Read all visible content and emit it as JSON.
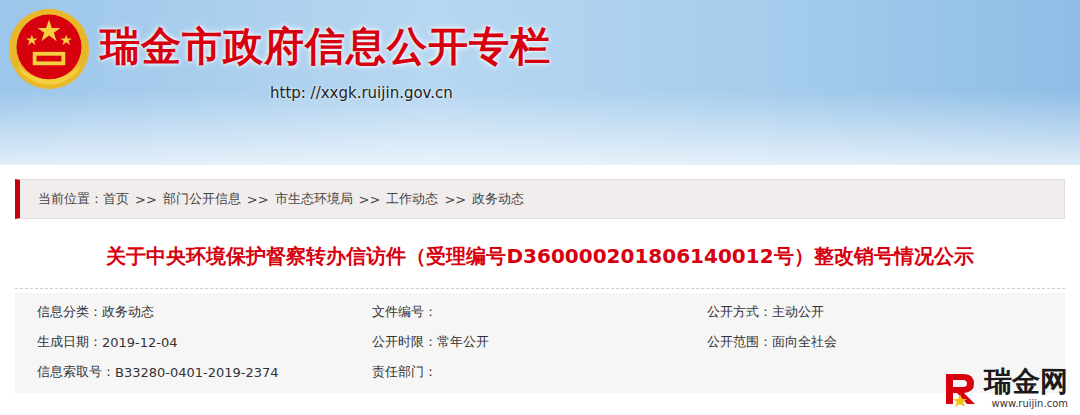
{
  "header": {
    "title": "瑞金市政府信息公开专栏",
    "url": "http: //xxgk.ruijin.gov.cn"
  },
  "breadcrumb": {
    "label": "当前位置：",
    "separator": ">>",
    "items": [
      "首页",
      "部门公开信息",
      "市生态环境局",
      "工作动态",
      "政务动态"
    ]
  },
  "article": {
    "title": "关于中央环境保护督察转办信访件（受理编号D360000201806140012号）整改销号情况公示"
  },
  "meta": [
    {
      "label": "信息分类：",
      "value": "政务动态"
    },
    {
      "label": "文件编号：",
      "value": ""
    },
    {
      "label": "公开方式：",
      "value": "主动公开"
    },
    {
      "label": "生成日期：",
      "value": "2019-12-04"
    },
    {
      "label": "公开时限：",
      "value": "常年公开"
    },
    {
      "label": "公开范围：",
      "value": "面向全社会"
    },
    {
      "label": "信息索取号：",
      "value": "B33280-0401-2019-2374"
    },
    {
      "label": "责任部门：",
      "value": ""
    }
  ],
  "watermark": {
    "name": "瑞金网",
    "url": "www.ruijin.com"
  }
}
